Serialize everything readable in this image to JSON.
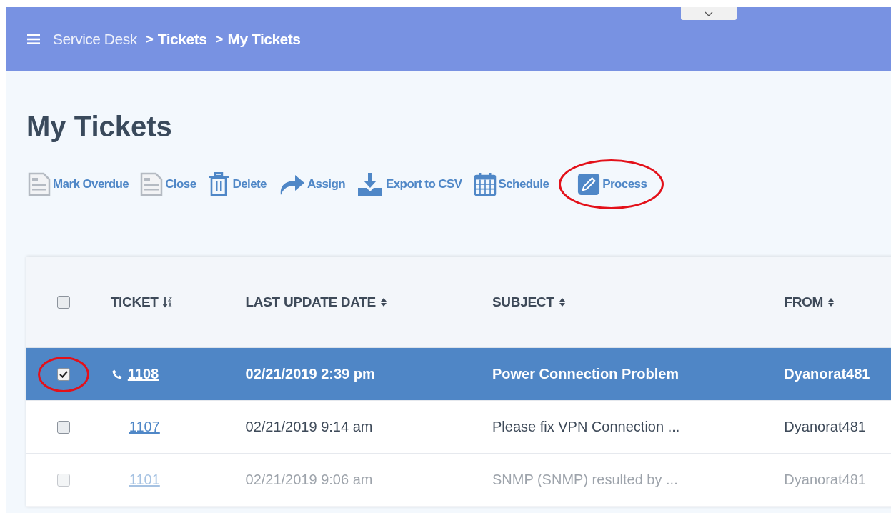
{
  "breadcrumb": {
    "items": [
      "Service Desk",
      "Tickets",
      "My Tickets"
    ],
    "separator": ">"
  },
  "page_title": "My Tickets",
  "toolbar": [
    {
      "label": "Mark Overdue",
      "kind": "document",
      "circled": false
    },
    {
      "label": "Close",
      "kind": "document",
      "circled": false
    },
    {
      "label": "Delete",
      "kind": "trash",
      "circled": false
    },
    {
      "label": "Assign",
      "kind": "arrow",
      "circled": false
    },
    {
      "label": "Export to CSV",
      "kind": "download",
      "circled": false
    },
    {
      "label": "Schedule",
      "kind": "calendar",
      "circled": false
    },
    {
      "label": "Process",
      "kind": "pencil",
      "circled": true
    }
  ],
  "table": {
    "select_all_checked": false,
    "columns": [
      {
        "label": "TICKET",
        "kind": "sorted"
      },
      {
        "label": "LAST UPDATE DATE",
        "kind": "sortable"
      },
      {
        "label": "SUBJECT",
        "kind": "sortable"
      },
      {
        "label": "FROM",
        "kind": "sortable"
      }
    ],
    "rows": [
      {
        "ticket": "1108",
        "phone": true,
        "date": "02/21/2019 2:39 pm",
        "subject": "Power Connection Problem",
        "from": "Dyanorat481",
        "selected": true,
        "checked": true,
        "circled": true,
        "faded": false
      },
      {
        "ticket": "1107",
        "phone": false,
        "date": "02/21/2019 9:14 am",
        "subject": "Please fix VPN Connection ...",
        "from": "Dyanorat481",
        "selected": false,
        "checked": false,
        "circled": false,
        "faded": false
      },
      {
        "ticket": "1101",
        "phone": false,
        "date": "02/21/2019 9:06 am",
        "subject": "SNMP (SNMP) resulted by ...",
        "from": "Dyanorat481",
        "selected": false,
        "checked": false,
        "circled": false,
        "faded": true
      }
    ]
  }
}
